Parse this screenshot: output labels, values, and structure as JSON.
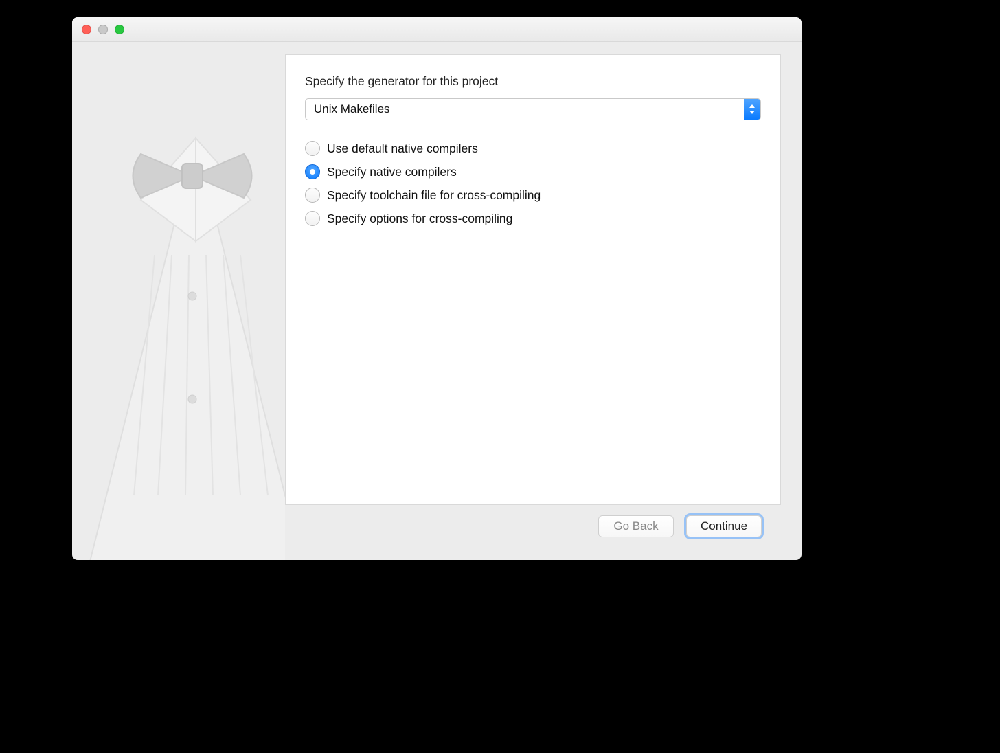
{
  "heading": "Specify the generator for this project",
  "generator_selected": "Unix Makefiles",
  "radios": [
    {
      "label": "Use default native compilers",
      "selected": false
    },
    {
      "label": "Specify native compilers",
      "selected": true
    },
    {
      "label": "Specify toolchain file for cross-compiling",
      "selected": false
    },
    {
      "label": "Specify options for cross-compiling",
      "selected": false
    }
  ],
  "buttons": {
    "back": "Go Back",
    "continue": "Continue"
  }
}
